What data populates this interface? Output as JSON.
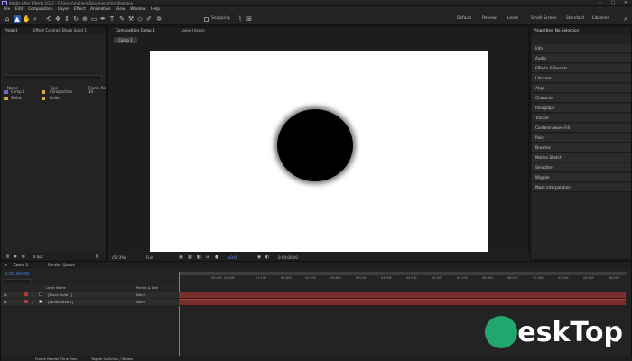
{
  "window": {
    "title": "Adobe After Effects 2023 - C:\\Users\\mohem\\Documents\\Untitled.aep"
  },
  "menu": [
    "File",
    "Edit",
    "Composition",
    "Layer",
    "Effect",
    "Animation",
    "View",
    "Window",
    "Help"
  ],
  "toolbar": {
    "snapping": "Snapping"
  },
  "workspaces": [
    "Default",
    "Review",
    "Learn",
    "Small Screen",
    "Standard",
    "Libraries"
  ],
  "project": {
    "tabs": [
      "Project",
      "Effect Controls Black Solid 1"
    ],
    "headers": {
      "name": "Name",
      "type": "Type",
      "size": "Frame Ra"
    },
    "items": [
      {
        "name": "Comp 1",
        "type": "Composition",
        "rate": "30"
      },
      {
        "name": "Solids",
        "type": "Folder",
        "rate": ""
      }
    ],
    "bpc": "8 bpc"
  },
  "composition": {
    "tabs": [
      "Composition Comp 1",
      "Layer (none)"
    ],
    "crumb": "Comp 1",
    "zoom": "(52.3%)",
    "quality": "Full",
    "timecode": "0:00:00:00",
    "exposure": "+0.0"
  },
  "properties": {
    "title": "Properties: No Selection",
    "items": [
      "Info",
      "Audio",
      "Effects & Presets",
      "Libraries",
      "Align",
      "Character",
      "Paragraph",
      "Tracker",
      "Content-Aware Fill",
      "Paint",
      "Brushes",
      "Motion Sketch",
      "Smoother",
      "Wiggler",
      "Mask Interpolation"
    ]
  },
  "timeline": {
    "tabs": [
      "Comp 1",
      "Render Queue"
    ],
    "timecode": "0:00:00:00",
    "headers": {
      "source": "Layer Name",
      "parent": "Parent & Link"
    },
    "layers": [
      {
        "num": "1",
        "name": "[Black Solid 1]",
        "parent": "None"
      },
      {
        "num": "2",
        "name": "[White Solid 1]",
        "parent": "None"
      }
    ],
    "ticks": [
      "00:15f",
      "01:00f",
      "01:15f",
      "02:00f",
      "02:15f",
      "03:00f",
      "03:15f",
      "04:00f",
      "04:15f",
      "05:00f",
      "05:15f",
      "06:00f",
      "06:15f",
      "07:00f",
      "07:15f",
      "08:00f",
      "08:15f"
    ],
    "footer": {
      "render": "Frame Render Time 3ms",
      "toggle": "Toggle Switches / Modes"
    }
  },
  "watermark": {
    "text": "eskTop"
  }
}
